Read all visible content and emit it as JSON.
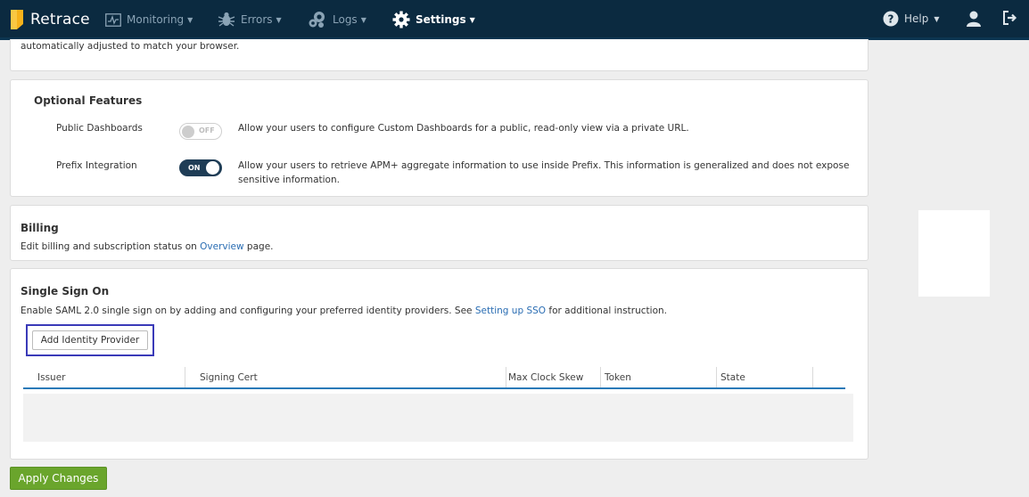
{
  "nav": {
    "brand": "Retrace",
    "items": [
      {
        "label": "Monitoring",
        "icon": "monitoring-icon"
      },
      {
        "label": "Errors",
        "icon": "bug-icon"
      },
      {
        "label": "Logs",
        "icon": "logs-icon"
      },
      {
        "label": "Settings",
        "icon": "gear-icon"
      }
    ],
    "help_label": "Help"
  },
  "top_note": "automatically adjusted to match your browser.",
  "optional_features": {
    "title": "Optional Features",
    "public_dashboards": {
      "label": "Public Dashboards",
      "toggle": "OFF",
      "description": "Allow your users to configure Custom Dashboards for a public, read-only view via a private URL."
    },
    "prefix_integration": {
      "label": "Prefix Integration",
      "toggle": "ON",
      "description_line1": "Allow your users to retrieve APM+ aggregate information to use inside Prefix. This information is generalized and does not expose",
      "description_line2": "sensitive information."
    }
  },
  "billing": {
    "title": "Billing",
    "text_before": "Edit billing and subscription status on ",
    "link": "Overview",
    "text_after": " page."
  },
  "sso": {
    "title": "Single Sign On",
    "text_before": "Enable SAML 2.0 single sign on by adding and configuring your preferred identity providers. See ",
    "link": "Setting up SSO",
    "text_after": " for additional instruction.",
    "add_button": "Add Identity Provider",
    "columns": [
      "Issuer",
      "Signing Cert",
      "Max Clock Skew",
      "Token",
      "State"
    ]
  },
  "apply_button": "Apply Changes",
  "colors": {
    "nav_bg": "#0b2a40",
    "accent_blue": "#2a7ab8",
    "apply_green": "#6aa52c",
    "highlight": "#3a3ab8"
  }
}
